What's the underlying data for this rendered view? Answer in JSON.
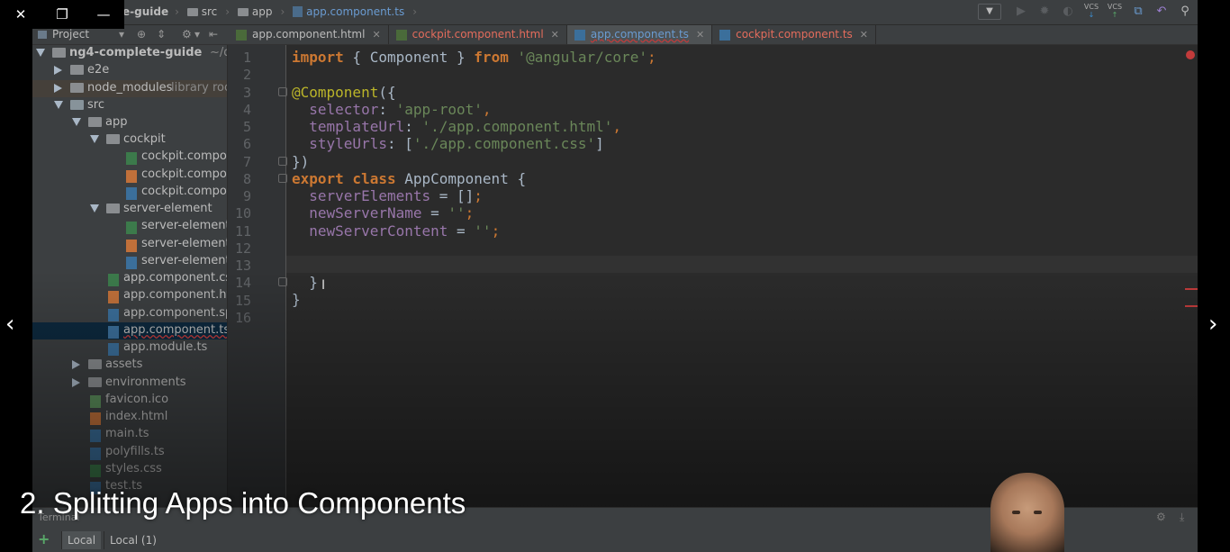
{
  "window_controls": {
    "close": "✕",
    "restore": "❐",
    "minimize": "—"
  },
  "breadcrumb": [
    "e-guide",
    "src",
    "app",
    "app.component.ts"
  ],
  "project_panel": {
    "title": "Project"
  },
  "tabs": [
    {
      "label": "app.component.html",
      "type": "html"
    },
    {
      "label": "cockpit.component.html",
      "type": "html"
    },
    {
      "label": "app.component.ts",
      "type": "ts"
    },
    {
      "label": "cockpit.component.ts",
      "type": "ts"
    }
  ],
  "tree": [
    {
      "label": "ng4-complete-guide",
      "suffix": "~/dev",
      "kind": "root"
    },
    {
      "label": "e2e",
      "kind": "folder"
    },
    {
      "label": "node_modules",
      "suffix": "library roo",
      "kind": "folder"
    },
    {
      "label": "src",
      "kind": "folder-open"
    },
    {
      "label": "app",
      "kind": "folder-open"
    },
    {
      "label": "cockpit",
      "kind": "folder-open"
    },
    {
      "label": "cockpit.compon",
      "kind": "file-css"
    },
    {
      "label": "cockpit.compon",
      "kind": "file-html"
    },
    {
      "label": "cockpit.compon",
      "kind": "file-ts"
    },
    {
      "label": "server-element",
      "kind": "folder-open"
    },
    {
      "label": "server-element.",
      "kind": "file-css"
    },
    {
      "label": "server-element.",
      "kind": "file-html"
    },
    {
      "label": "server-element",
      "kind": "file-ts"
    },
    {
      "label": "app.component.cs",
      "kind": "file-css"
    },
    {
      "label": "app.component.ht",
      "kind": "file-html"
    },
    {
      "label": "app.component.sp",
      "kind": "file-ts"
    },
    {
      "label": "app.component.ts",
      "kind": "file-ts"
    },
    {
      "label": "app.module.ts",
      "kind": "file-ts"
    },
    {
      "label": "assets",
      "kind": "folder"
    },
    {
      "label": "environments",
      "kind": "folder"
    },
    {
      "label": "favicon.ico",
      "kind": "file"
    },
    {
      "label": "index.html",
      "kind": "file"
    },
    {
      "label": "main.ts",
      "kind": "file"
    },
    {
      "label": "polyfills.ts",
      "kind": "file"
    },
    {
      "label": "styles.css",
      "kind": "file"
    },
    {
      "label": "test.ts",
      "kind": "file"
    }
  ],
  "line_numbers": [
    "1",
    "2",
    "3",
    "4",
    "5",
    "6",
    "7",
    "8",
    "9",
    "10",
    "11",
    "12",
    "13",
    "14",
    "15",
    "16"
  ],
  "code": {
    "l1_kw": "import",
    "l1_a": " { Component } ",
    "l1_kw2": "from",
    "l1_str": " '@angular/core'",
    "l1_p": ";",
    "l3_ann": "@Component",
    "l3_rest": "({",
    "l4_fld": "  selector",
    "l4_c": ": ",
    "l4_str": "'app-root'",
    "l4_p": ",",
    "l5_fld": "  templateUrl",
    "l5_c": ": ",
    "l5_str": "'./app.component.html'",
    "l5_p": ",",
    "l6_fld": "  styleUrls",
    "l6_c": ": [",
    "l6_str": "'./app.component.css'",
    "l6_e": "]",
    "l7": "})",
    "l8_kw": "export class",
    "l8_rest": " AppComponent {",
    "l9_fld": "  serverElements",
    "l9_rest": " = []",
    "l9_p": ";",
    "l10_fld": "  newServerName",
    "l10_rest": " = ",
    "l10_str": "''",
    "l10_p": ";",
    "l11_fld": "  newServerContent",
    "l11_rest": " = ",
    "l11_str": "''",
    "l11_p": ";",
    "l14": "  }",
    "l15": "}"
  },
  "terminal": {
    "title": "Terminal",
    "tabs": [
      "Local",
      "Local (1)"
    ]
  },
  "caption": "2. Splitting Apps into Components",
  "nav": {
    "prev": "‹",
    "next": "›"
  },
  "colors": {
    "keyword": "#cc7832",
    "string": "#6a8759",
    "annotation": "#bbb529",
    "field": "#9876aa",
    "background": "#2b2b2b"
  }
}
